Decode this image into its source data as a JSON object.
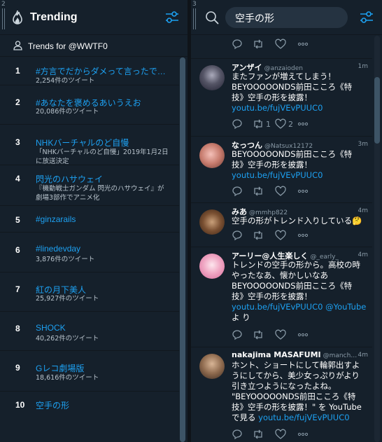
{
  "trending": {
    "col_number": "2",
    "title": "Trending",
    "subtitle": "Trends for @WWTF0",
    "items": [
      {
        "rank": "1",
        "name": "#方言でだからダメって言ったで…",
        "meta": "2,254件のツイート"
      },
      {
        "rank": "2",
        "name": "#あなたを褒めるあいうえお",
        "meta": "20,086件のツイート"
      },
      {
        "rank": "3",
        "name": "NHKバーチャルのど自慢",
        "meta": "「NHKバーチャルのど自慢」2019年1月2日に放送決定"
      },
      {
        "rank": "4",
        "name": "閃光のハサウェイ",
        "meta": "『機動戦士ガンダム 閃光のハサウェイ』が劇場3部作でアニメ化"
      },
      {
        "rank": "5",
        "name": "#ginzarails",
        "meta": ""
      },
      {
        "rank": "6",
        "name": "#linedevday",
        "meta": "3,876件のツイート"
      },
      {
        "rank": "7",
        "name": "紅の月下美人",
        "meta": "25,927件のツイート"
      },
      {
        "rank": "8",
        "name": "SHOCK",
        "meta": "40,262件のツイート"
      },
      {
        "rank": "9",
        "name": "Gレコ劇場版",
        "meta": "18,616件のツイート"
      },
      {
        "rank": "10",
        "name": "空手の形",
        "meta": ""
      }
    ]
  },
  "search": {
    "col_number": "3",
    "query": "空手の形"
  },
  "tweets": [
    {
      "name": "アンザイ",
      "handle": "@anzaioden",
      "time": "1m",
      "lines": [
        "またファンが増えてしまう！",
        "BEYOOOOONDS前田こころ《特",
        "技》空手の形を披露！"
      ],
      "link": "youtu.be/fujVEvPUUC0",
      "tail": "",
      "retweets": "1",
      "likes": "2"
    },
    {
      "name": "なっつん",
      "handle": "@Natsux12172",
      "time": "3m",
      "lines": [
        "BEYOOOOONDS前田こころ《特",
        "技》空手の形を披露！"
      ],
      "link": "youtu.be/fujVEvPUUC0",
      "tail": "",
      "retweets": "",
      "likes": ""
    },
    {
      "name": "みあ",
      "handle": "@mmhp822",
      "time": "4m",
      "lines": [
        "空手の形がトレンド入りしている🤔"
      ],
      "link": "",
      "tail": "",
      "retweets": "",
      "likes": ""
    },
    {
      "name": "アーリー@人生楽しく",
      "handle": "@_early_",
      "time": "4m",
      "lines": [
        "トレンドの空手の形から。高校の時",
        "やったなあ、懐かしいなあ",
        "BEYOOOOONDS前田こころ《特",
        "技》空手の形を披露！"
      ],
      "link": "youtu.be/fujVEvPUUC0 @YouTube",
      "tail": "よ り",
      "retweets": "",
      "likes": ""
    },
    {
      "name": "nakajima MASAFUMI",
      "handle": "@manch…",
      "time": "4m",
      "lines": [
        "ホント、ショートにして輪郭出すよ",
        "うにしてから、美少女っぷりがより",
        "引き立つようになったよね。",
        "\"BEYOOOOONDS前田こころ《特",
        "技》空手の形を披露！\" を YouTube",
        "で見る"
      ],
      "link": "youtu.be/fujVEvPUUC0",
      "tail": "",
      "retweets": "",
      "likes": ""
    }
  ],
  "colors": {
    "accent": "#1da1f2",
    "bg": "#15202b",
    "text": "#ffffff",
    "muted": "#8899a6"
  }
}
